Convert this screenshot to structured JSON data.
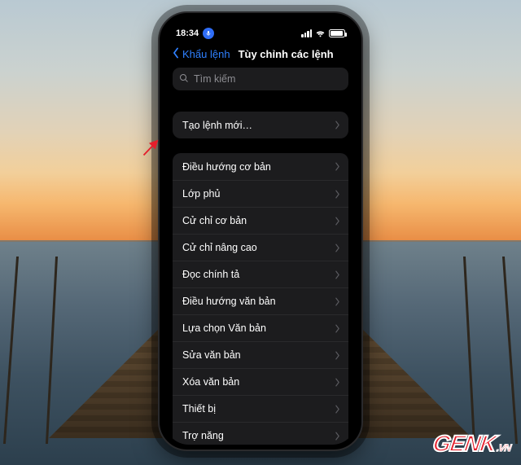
{
  "status": {
    "time": "18:34"
  },
  "nav": {
    "back_label": "Khẩu lệnh",
    "title": "Tùy chỉnh các lệnh"
  },
  "search": {
    "placeholder": "Tìm kiếm"
  },
  "create_label": "Tạo lệnh mới…",
  "categories": [
    {
      "label": "Điều hướng cơ bản"
    },
    {
      "label": "Lớp phủ"
    },
    {
      "label": "Cử chỉ cơ bản"
    },
    {
      "label": "Cử chỉ nâng cao"
    },
    {
      "label": "Đọc chính tả"
    },
    {
      "label": "Điều hướng văn bản"
    },
    {
      "label": "Lựa chọn Văn bản"
    },
    {
      "label": "Sửa văn bản"
    },
    {
      "label": "Xóa văn bản"
    },
    {
      "label": "Thiết bị"
    },
    {
      "label": "Trợ năng"
    }
  ],
  "brand": {
    "name": "GENK",
    "suffix": ".VN"
  }
}
